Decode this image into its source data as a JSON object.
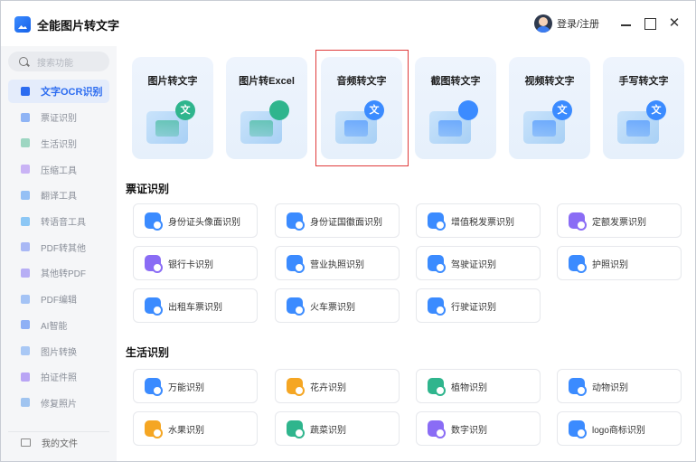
{
  "app": {
    "title": "全能图片转文字",
    "login": "登录/注册"
  },
  "window_controls": {
    "minimize": "",
    "maximize": "",
    "close": "✕"
  },
  "search": {
    "placeholder": "搜索功能"
  },
  "sidebar": {
    "items": [
      {
        "label": "文字OCR识别",
        "icon": "ocr-icon",
        "color": "#2c6cf0",
        "active": true
      },
      {
        "label": "票证识别",
        "icon": "ticket-icon",
        "color": "#8fb4f5"
      },
      {
        "label": "生活识别",
        "icon": "life-icon",
        "color": "#9dd6c2"
      },
      {
        "label": "压缩工具",
        "icon": "compress-icon",
        "color": "#c9b3f5"
      },
      {
        "label": "翻译工具",
        "icon": "translate-icon",
        "color": "#95c0f5"
      },
      {
        "label": "转语音工具",
        "icon": "voice-icon",
        "color": "#8cc7f5"
      },
      {
        "label": "PDF转其他",
        "icon": "pdf-icon",
        "color": "#a9b8f5"
      },
      {
        "label": "其他转PDF",
        "icon": "to-pdf-icon",
        "color": "#b7aef5"
      },
      {
        "label": "PDF编辑",
        "icon": "pdf-edit-icon",
        "color": "#a4c3f5"
      },
      {
        "label": "AI智能",
        "icon": "ai-icon",
        "color": "#8fb0f5"
      },
      {
        "label": "图片转换",
        "icon": "image-convert-icon",
        "color": "#a9c8f5"
      },
      {
        "label": "拍证件照",
        "icon": "id-photo-icon",
        "color": "#b9a5f5"
      },
      {
        "label": "修复照片",
        "icon": "repair-photo-icon",
        "color": "#a0c4f0"
      }
    ],
    "footer": "我的文件"
  },
  "tools": [
    {
      "label": "图片转文字",
      "icon": "image-to-text-icon",
      "badge": "文",
      "badge_color": "#2fb58d"
    },
    {
      "label": "图片转Excel",
      "icon": "image-to-excel-icon",
      "badge": "",
      "badge_color": "#2fb58d"
    },
    {
      "label": "音频转文字",
      "icon": "audio-to-text-icon",
      "badge": "文",
      "badge_color": "#3b8bff"
    },
    {
      "label": "截图转文字",
      "icon": "screenshot-to-text-icon",
      "badge": "",
      "badge_color": "#3b8bff"
    },
    {
      "label": "视频转文字",
      "icon": "video-to-text-icon",
      "badge": "文",
      "badge_color": "#3b8bff"
    },
    {
      "label": "手写转文字",
      "icon": "handwriting-to-text-icon",
      "badge": "文",
      "badge_color": "#3b8bff"
    }
  ],
  "sections": {
    "ticket": {
      "title": "票证识别",
      "items": [
        {
          "label": "身份证头像面识别",
          "icon": "id-card-front-icon",
          "color": "#3b8bff"
        },
        {
          "label": "身份证国徽面识别",
          "icon": "id-card-back-icon",
          "color": "#3b8bff"
        },
        {
          "label": "增值税发票识别",
          "icon": "vat-invoice-icon",
          "color": "#3b8bff"
        },
        {
          "label": "定额发票识别",
          "icon": "quota-invoice-icon",
          "color": "#8a6cf5"
        },
        {
          "label": "银行卡识别",
          "icon": "bank-card-icon",
          "color": "#8a6cf5"
        },
        {
          "label": "营业执照识别",
          "icon": "business-license-icon",
          "color": "#3b8bff"
        },
        {
          "label": "驾驶证识别",
          "icon": "driver-license-icon",
          "color": "#3b8bff"
        },
        {
          "label": "护照识别",
          "icon": "passport-icon",
          "color": "#3b8bff"
        },
        {
          "label": "出租车票识别",
          "icon": "taxi-ticket-icon",
          "color": "#3b8bff"
        },
        {
          "label": "火车票识别",
          "icon": "train-ticket-icon",
          "color": "#3b8bff"
        },
        {
          "label": "行驶证识别",
          "icon": "vehicle-license-icon",
          "color": "#3b8bff"
        }
      ]
    },
    "life": {
      "title": "生活识别",
      "items": [
        {
          "label": "万能识别",
          "icon": "universal-icon",
          "color": "#3b8bff"
        },
        {
          "label": "花卉识别",
          "icon": "flower-icon",
          "color": "#f5a623"
        },
        {
          "label": "植物识别",
          "icon": "plant-icon",
          "color": "#2fb58d"
        },
        {
          "label": "动物识别",
          "icon": "animal-icon",
          "color": "#3b8bff"
        },
        {
          "label": "水果识别",
          "icon": "fruit-icon",
          "color": "#f5a623"
        },
        {
          "label": "蔬菜识别",
          "icon": "vegetable-icon",
          "color": "#2fb58d"
        },
        {
          "label": "数字识别",
          "icon": "digit-icon",
          "color": "#8a6cf5"
        },
        {
          "label": "logo商标识别",
          "icon": "logo-icon",
          "color": "#3b8bff"
        }
      ]
    }
  }
}
